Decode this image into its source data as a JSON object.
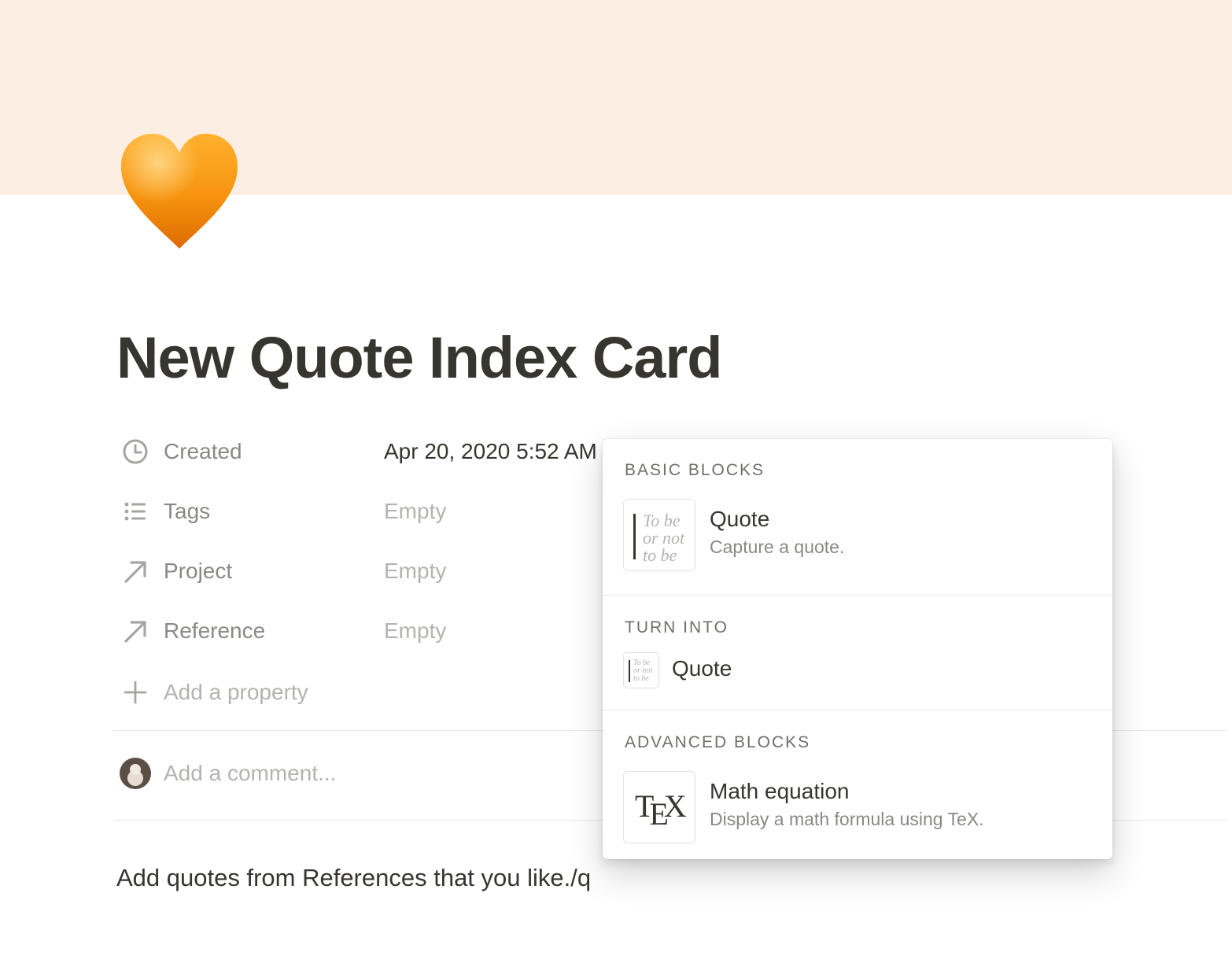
{
  "page": {
    "title": "New Quote Index Card",
    "icon": "orange-heart-icon",
    "cover_color": "#fdeee4"
  },
  "properties": [
    {
      "icon": "clock-icon",
      "label": "Created",
      "value": "Apr 20, 2020 5:52 AM"
    },
    {
      "icon": "list-icon",
      "label": "Tags",
      "value": "Empty"
    },
    {
      "icon": "arrow-up-right-icon",
      "label": "Project",
      "value": "Empty"
    },
    {
      "icon": "arrow-up-right-icon",
      "label": "Reference",
      "value": "Empty"
    }
  ],
  "add_property": {
    "icon": "plus-icon",
    "label": "Add a property"
  },
  "comment": {
    "placeholder": "Add a comment..."
  },
  "body": {
    "text": "Add quotes from References that you like./q"
  },
  "menu": {
    "basic_blocks": {
      "header": "BASIC BLOCKS",
      "items": [
        {
          "icon": "quote-thumbnail-icon",
          "thumb_text": "To be\nor not\nto be",
          "title": "Quote",
          "description": "Capture a quote."
        }
      ]
    },
    "turn_into": {
      "header": "TURN INTO",
      "items": [
        {
          "icon": "quote-thumbnail-icon",
          "thumb_text": "To be\nor not\nto be",
          "title": "Quote"
        }
      ]
    },
    "advanced_blocks": {
      "header": "ADVANCED BLOCKS",
      "items": [
        {
          "icon": "tex-icon",
          "title": "Math equation",
          "description": "Display a math formula using TeX."
        }
      ]
    }
  }
}
